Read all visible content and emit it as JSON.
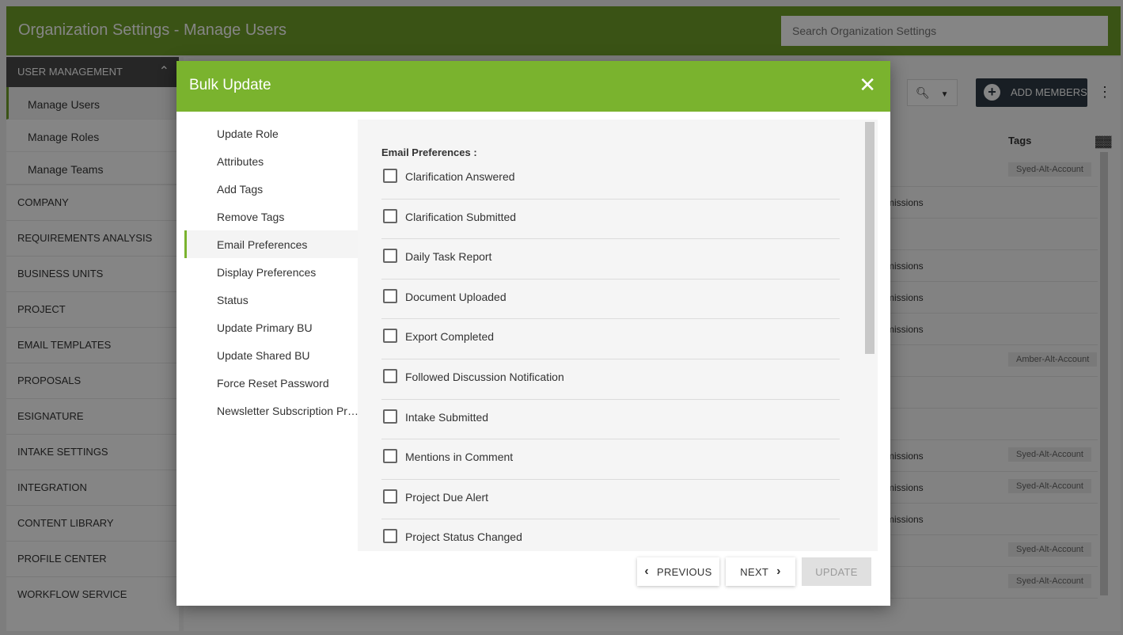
{
  "app": {
    "title": "Organization Settings - Manage Users",
    "search_placeholder": "Search Organization Settings"
  },
  "sidebar": {
    "section_header": "USER MANAGEMENT",
    "sub_items": [
      {
        "label": "Manage Users",
        "active": true
      },
      {
        "label": "Manage Roles",
        "active": false
      },
      {
        "label": "Manage Teams",
        "active": false
      }
    ],
    "items": [
      "COMPANY",
      "REQUIREMENTS ANALYSIS",
      "BUSINESS UNITS",
      "PROJECT",
      "EMAIL TEMPLATES",
      "PROPOSALS",
      "ESIGNATURE",
      "INTAKE SETTINGS",
      "INTEGRATION",
      "CONTENT LIBRARY",
      "PROFILE CENTER",
      "WORKFLOW SERVICE"
    ]
  },
  "main": {
    "add_members_label": "ADD MEMBERS",
    "tags_header": "Tags",
    "rows": [
      {
        "perm": "",
        "tag": "Syed-Alt-Account"
      },
      {
        "perm": "missions",
        "tag": ""
      },
      {
        "perm": "",
        "tag": ""
      },
      {
        "perm": "missions",
        "tag": ""
      },
      {
        "perm": "missions",
        "tag": ""
      },
      {
        "perm": "missions",
        "tag": ""
      },
      {
        "perm": "",
        "tag": "Amber-Alt-Account"
      },
      {
        "perm": "",
        "tag": ""
      },
      {
        "perm": "",
        "tag": ""
      },
      {
        "perm": "missions",
        "tag": "Syed-Alt-Account"
      },
      {
        "perm": "missions",
        "tag": "Syed-Alt-Account"
      },
      {
        "perm": "missions",
        "tag": ""
      },
      {
        "perm": "",
        "tag": "Syed-Alt-Account"
      },
      {
        "perm": "",
        "tag": "Syed-Alt-Account"
      }
    ]
  },
  "modal": {
    "title": "Bulk Update",
    "nav": [
      {
        "label": "Update Role",
        "active": false
      },
      {
        "label": "Attributes",
        "active": false
      },
      {
        "label": "Add Tags",
        "active": false
      },
      {
        "label": "Remove Tags",
        "active": false
      },
      {
        "label": "Email Preferences",
        "active": true
      },
      {
        "label": "Display Preferences",
        "active": false
      },
      {
        "label": "Status",
        "active": false
      },
      {
        "label": "Update Primary BU",
        "active": false
      },
      {
        "label": "Update Shared BU",
        "active": false
      },
      {
        "label": "Force Reset Password",
        "active": false
      },
      {
        "label": "Newsletter Subscription Pre…",
        "active": false
      }
    ],
    "section_label": "Email Preferences :",
    "options": [
      {
        "label": "Clarification Answered",
        "checked": false
      },
      {
        "label": "Clarification Submitted",
        "checked": false
      },
      {
        "label": "Daily Task Report",
        "checked": false
      },
      {
        "label": "Document Uploaded",
        "checked": false
      },
      {
        "label": "Export Completed",
        "checked": false
      },
      {
        "label": "Followed Discussion Notification",
        "checked": false
      },
      {
        "label": "Intake Submitted",
        "checked": false
      },
      {
        "label": "Mentions in Comment",
        "checked": false
      },
      {
        "label": "Project Due Alert",
        "checked": false
      },
      {
        "label": "Project Status Changed",
        "checked": false
      }
    ],
    "buttons": {
      "previous": "PREVIOUS",
      "next": "NEXT",
      "update": "UPDATE"
    }
  },
  "colors": {
    "brand_green": "#7ab32e",
    "header_green": "#6f9f2a",
    "dark_button": "#2e3b45"
  }
}
